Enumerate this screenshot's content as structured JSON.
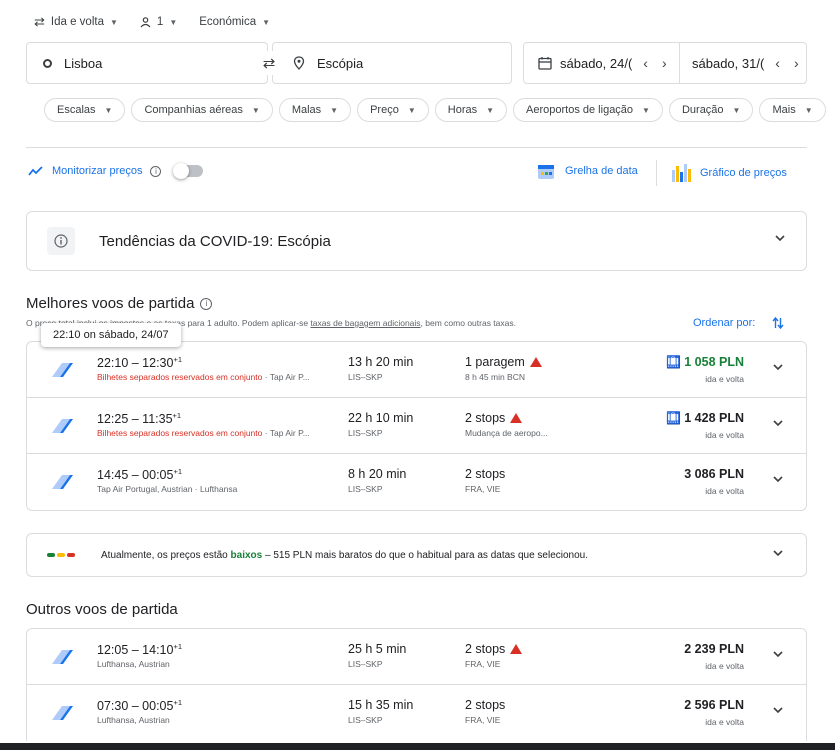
{
  "trip_options": {
    "trip_type": "Ida e volta",
    "passengers": "1",
    "cabin": "Económica"
  },
  "search": {
    "origin": "Lisboa",
    "destination": "Escópia",
    "depart_date": "sábado, 24/(",
    "return_date": "sábado, 31/("
  },
  "filters": [
    "Escalas",
    "Companhias aéreas",
    "Malas",
    "Preço",
    "Horas",
    "Aeroportos de ligação",
    "Duração",
    "Mais"
  ],
  "monitor": {
    "label": "Monitorizar preços"
  },
  "tools": {
    "date_grid": "Grelha de data",
    "price_graph": "Gráfico de preços"
  },
  "covid": {
    "label": "Tendências da COVID-19: Escópia"
  },
  "best": {
    "title": "Melhores voos de partida",
    "disclaimer_prefix": "O preço total inclui os impostos e as taxas para 1 adulto. Podem aplicar-se ",
    "disclaimer_link": "taxas de bagagem adicionais",
    "disclaimer_suffix": ", bem como outras taxas.",
    "order_label": "Ordenar por:",
    "tooltip": "22:10 on sábado, 24/07"
  },
  "best_flights": [
    {
      "time": "22:10 – 12:30",
      "plus": "+1",
      "sub_red": "Bilhetes separados reservados em conjunto",
      "sub": " · Tap Air P...",
      "duration": "13 h 20 min",
      "route": "LIS–SKP",
      "stops": "1 paragem",
      "warn": true,
      "stops_sub": "8 h 45 min BCN",
      "price": "1 058 PLN",
      "price_green": true,
      "no_bag": true,
      "price_sub": "ida e volta"
    },
    {
      "time": "12:25 – 11:35",
      "plus": "+1",
      "sub_red": "Bilhetes separados reservados em conjunto",
      "sub": " · Tap Air P...",
      "duration": "22 h 10 min",
      "route": "LIS–SKP",
      "stops": "2 stops",
      "warn": true,
      "stops_sub": "Mudança de aeropo...",
      "price": "1 428 PLN",
      "price_green": false,
      "no_bag": true,
      "price_sub": "ida e volta"
    },
    {
      "time": "14:45 – 00:05",
      "plus": "+1",
      "sub_red": "",
      "sub": "Tap Air Portugal, Austrian · Lufthansa",
      "duration": "8 h 20 min",
      "route": "LIS–SKP",
      "stops": "2 stops",
      "warn": false,
      "stops_sub": "FRA, VIE",
      "price": "3 086 PLN",
      "price_green": false,
      "no_bag": false,
      "price_sub": "ida e volta"
    }
  ],
  "price_insight": {
    "prefix": "Atualmente, os preços estão ",
    "level": "baixos",
    "suffix": " – 515 PLN mais baratos do que o habitual para as datas que selecionou."
  },
  "other": {
    "title": "Outros voos de partida"
  },
  "other_flights": [
    {
      "time": "12:05 – 14:10",
      "plus": "+1",
      "sub_red": "",
      "sub": "Lufthansa, Austrian",
      "duration": "25 h 5 min",
      "route": "LIS–SKP",
      "stops": "2 stops",
      "warn": true,
      "stops_sub": "FRA, VIE",
      "price": "2 239 PLN",
      "price_green": false,
      "no_bag": false,
      "price_sub": "ida e volta"
    },
    {
      "time": "07:30 – 00:05",
      "plus": "+1",
      "sub_red": "",
      "sub": "Lufthansa, Austrian",
      "duration": "15 h 35 min",
      "route": "LIS–SKP",
      "stops": "2 stops",
      "warn": false,
      "stops_sub": "FRA, VIE",
      "price": "2 596 PLN",
      "price_green": false,
      "no_bag": false,
      "price_sub": "ida e volta"
    }
  ],
  "colors": {
    "accent": "#1a73e8",
    "low_price": "#188038",
    "warning": "#d93025"
  }
}
